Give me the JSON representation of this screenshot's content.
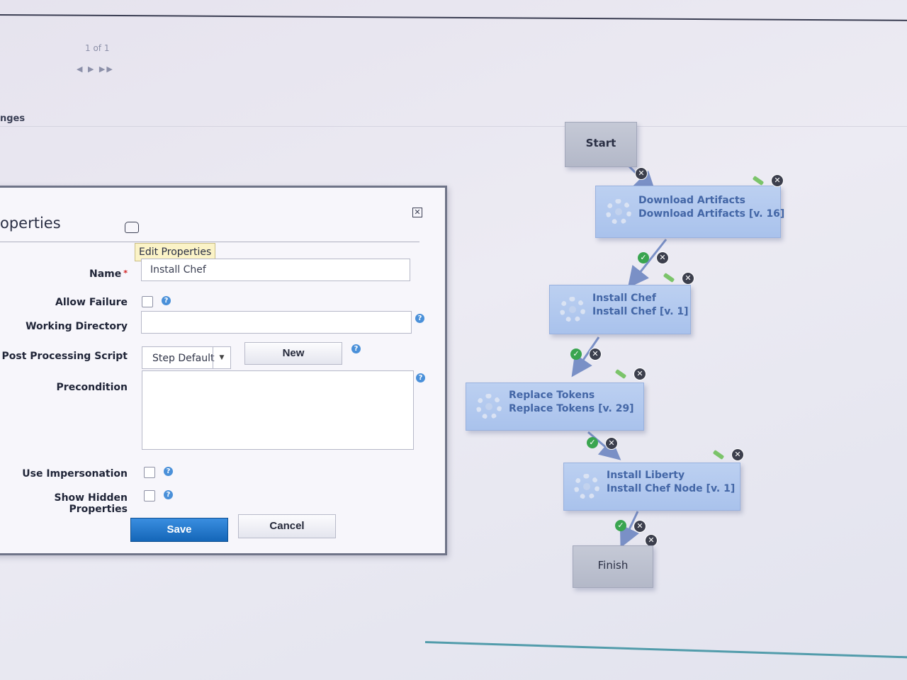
{
  "pager": {
    "text": "1 of 1",
    "nav": "◀ ▶ ▶▶"
  },
  "section": {
    "label": "nges"
  },
  "dialog": {
    "title": "operties",
    "tooltip": "Edit Properties",
    "close_glyph": "✕",
    "fields": {
      "name_label": "Name",
      "name_value": "Install Chef",
      "allow_failure_label": "Allow Failure",
      "allow_failure_checked": false,
      "working_directory_label": "Working Directory",
      "working_directory_value": "",
      "post_processing_label": "Post Processing Script",
      "post_processing_value": "Step Default",
      "new_label": "New",
      "precondition_label": "Precondition",
      "precondition_value": "",
      "use_impersonation_label": "Use Impersonation",
      "use_impersonation_checked": false,
      "show_hidden_label": "Show Hidden Properties",
      "show_hidden_checked": false
    },
    "buttons": {
      "save": "Save",
      "cancel": "Cancel"
    }
  },
  "workflow": {
    "start": "Start",
    "finish": "Finish",
    "steps": [
      {
        "title": "Download Artifacts",
        "sub": "Download Artifacts [v. 16]"
      },
      {
        "title": "Install Chef",
        "sub": "Install Chef [v. 1]"
      },
      {
        "title": "Replace Tokens",
        "sub": "Replace Tokens [v. 29]"
      },
      {
        "title": "Install Liberty",
        "sub": "Install Chef Node [v. 1]"
      }
    ]
  },
  "colors": {
    "primary_button": "#1a6fc2",
    "step_fill": "#b3c9ef",
    "step_text": "#4366a6"
  }
}
